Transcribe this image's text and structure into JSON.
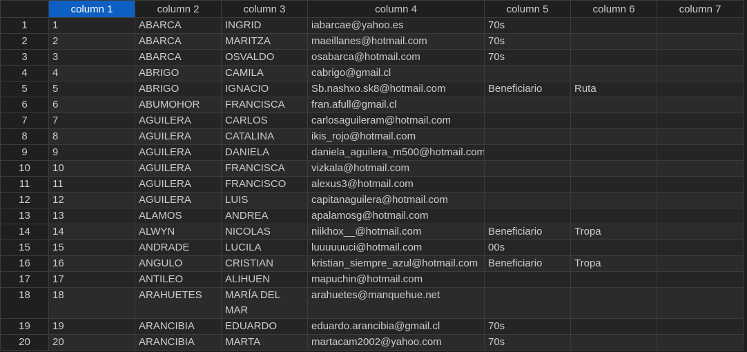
{
  "grid": {
    "columns": [
      "column 1",
      "column 2",
      "column 3",
      "column 4",
      "column 5",
      "column 6",
      "column 7"
    ],
    "selected_column": "column 1",
    "rows": [
      [
        "1",
        "1",
        "ABARCA",
        "INGRID",
        "iabarcae@yahoo.es",
        "70s",
        "",
        ""
      ],
      [
        "2",
        "2",
        "ABARCA",
        "MARITZA",
        "maeillanes@hotmail.com",
        "70s",
        "",
        ""
      ],
      [
        "3",
        "3",
        "ABARCA",
        "OSVALDO",
        "osabarca@hotmail.com",
        "70s",
        "",
        ""
      ],
      [
        "4",
        "4",
        "ABRIGO",
        "CAMILA",
        "cabrigo@gmail.cl",
        "",
        "",
        ""
      ],
      [
        "5",
        "5",
        "ABRIGO",
        "IGNACIO",
        "Sb.nashxo.sk8@hotmail.com",
        "Beneficiario",
        "Ruta",
        ""
      ],
      [
        "6",
        "6",
        "ABUMOHOR",
        "FRANCISCA",
        "fran.afull@gmail.cl",
        "",
        "",
        ""
      ],
      [
        "7",
        "7",
        "AGUILERA",
        "CARLOS",
        "carlosaguileram@hotmail.com",
        "",
        "",
        ""
      ],
      [
        "8",
        "8",
        "AGUILERA",
        "CATALINA",
        "ikis_rojo@hotmail.com",
        "",
        "",
        ""
      ],
      [
        "9",
        "9",
        "AGUILERA",
        "DANIELA",
        "daniela_aguilera_m500@hotmail.com",
        "",
        "",
        ""
      ],
      [
        "10",
        "10",
        "AGUILERA",
        "FRANCISCA",
        "vizkala@hotmail.com",
        "",
        "",
        ""
      ],
      [
        "11",
        "11",
        "AGUILERA",
        "FRANCISCO",
        "alexus3@hotmail.com",
        "",
        "",
        ""
      ],
      [
        "12",
        "12",
        "AGUILERA",
        "LUIS",
        "capitanaguilera@hotmail.com",
        "",
        "",
        ""
      ],
      [
        "13",
        "13",
        "ALAMOS",
        "ANDREA",
        "apalamosg@hotmail.com",
        "",
        "",
        ""
      ],
      [
        "14",
        "14",
        "ALWYN",
        "NICOLAS",
        "niikhox__@hotmail.com",
        "Beneficiario",
        "Tropa",
        ""
      ],
      [
        "15",
        "15",
        "ANDRADE",
        "LUCILA",
        "luuuuuuci@hotmail.com",
        "00s",
        "",
        ""
      ],
      [
        "16",
        "16",
        "ANGULO",
        "CRISTIAN",
        "kristian_siempre_azul@hotmail.com",
        "Beneficiario",
        "Tropa",
        ""
      ],
      [
        "17",
        "17",
        "ANTILEO",
        "ALIHUEN",
        "mapuchin@hotmail.com",
        "",
        "",
        ""
      ],
      [
        "18",
        "18",
        "ARAHUETES",
        "MARÍA DEL MAR",
        "arahuetes@manquehue.net",
        "",
        "",
        ""
      ],
      [
        "19",
        "19",
        "ARANCIBIA",
        "EDUARDO",
        "eduardo.arancibia@gmail.cl",
        "70s",
        "",
        ""
      ],
      [
        "20",
        "20",
        "ARANCIBIA",
        "MARTA",
        "martacam2002@yahoo.com",
        "70s",
        "",
        ""
      ]
    ]
  }
}
